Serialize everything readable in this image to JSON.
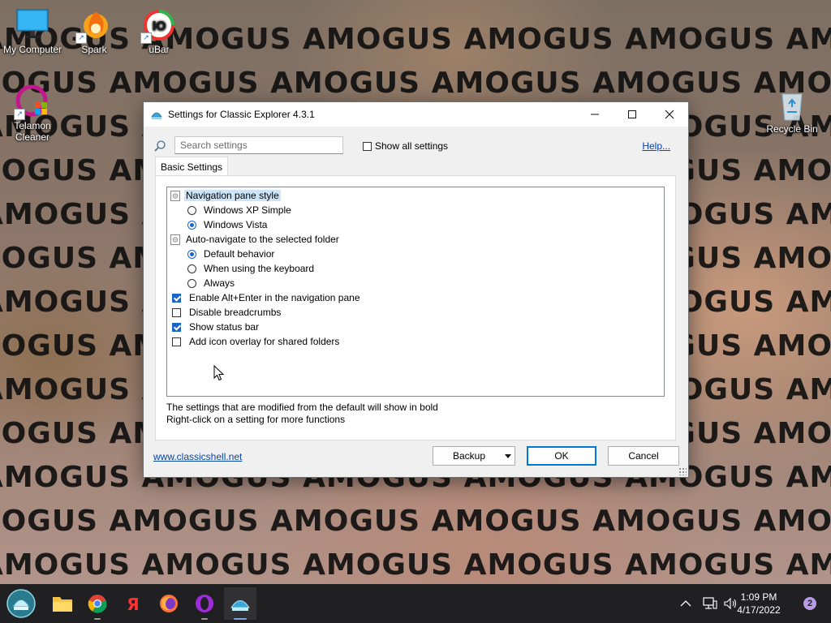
{
  "wallpaper": {
    "text": "AMOGUS AMOGUS AMOGUS AMOGUS AMOGUS AMOGUS AMOGUS AMOGUS"
  },
  "desktop_icons": [
    {
      "label": "My Computer",
      "icon": "monitor-icon"
    },
    {
      "label": "Spark",
      "icon": "spark-icon"
    },
    {
      "label": "uBar",
      "icon": "ubar-icon"
    },
    {
      "label": "Telamon Cleaner",
      "icon": "telamon-icon"
    },
    {
      "label": "Recycle Bin",
      "icon": "recycle-bin-icon"
    }
  ],
  "dialog": {
    "title": "Settings for Classic Explorer 4.3.1",
    "search_placeholder": "Search settings",
    "show_all_label": "Show all settings",
    "show_all_checked": false,
    "help_label": "Help...",
    "tab_label": "Basic Settings",
    "settings": [
      {
        "type": "group",
        "label": "Navigation pane style",
        "selected": true
      },
      {
        "type": "radio",
        "label": "Windows XP Simple",
        "checked": false
      },
      {
        "type": "radio",
        "label": "Windows Vista",
        "checked": true
      },
      {
        "type": "group",
        "label": "Auto-navigate to the selected folder",
        "selected": false
      },
      {
        "type": "radio",
        "label": "Default behavior",
        "checked": true
      },
      {
        "type": "radio",
        "label": "When using the keyboard",
        "checked": false
      },
      {
        "type": "radio",
        "label": "Always",
        "checked": false
      },
      {
        "type": "checkbox",
        "label": "Enable Alt+Enter in the navigation pane",
        "checked": true
      },
      {
        "type": "checkbox",
        "label": "Disable breadcrumbs",
        "checked": false
      },
      {
        "type": "checkbox",
        "label": "Show status bar",
        "checked": true
      },
      {
        "type": "checkbox",
        "label": "Add icon overlay for shared folders",
        "checked": false
      }
    ],
    "note_line1": "The settings that are modified from the default will show in bold",
    "note_line2": "Right-click on a setting for more functions",
    "website_link": "www.classicshell.net",
    "backup_label": "Backup",
    "ok_label": "OK",
    "cancel_label": "Cancel"
  },
  "taskbar": {
    "apps": [
      "start-shell-icon",
      "file-explorer-icon",
      "chrome-icon",
      "yandex-icon",
      "firefox-icon",
      "opera-icon",
      "classic-shell-icon"
    ],
    "time": "1:09 PM",
    "date": "4/17/2022",
    "notification_count": "2"
  },
  "colors": {
    "accent": "#1a63c7",
    "link": "#0645ad",
    "taskbar": "#202022"
  }
}
